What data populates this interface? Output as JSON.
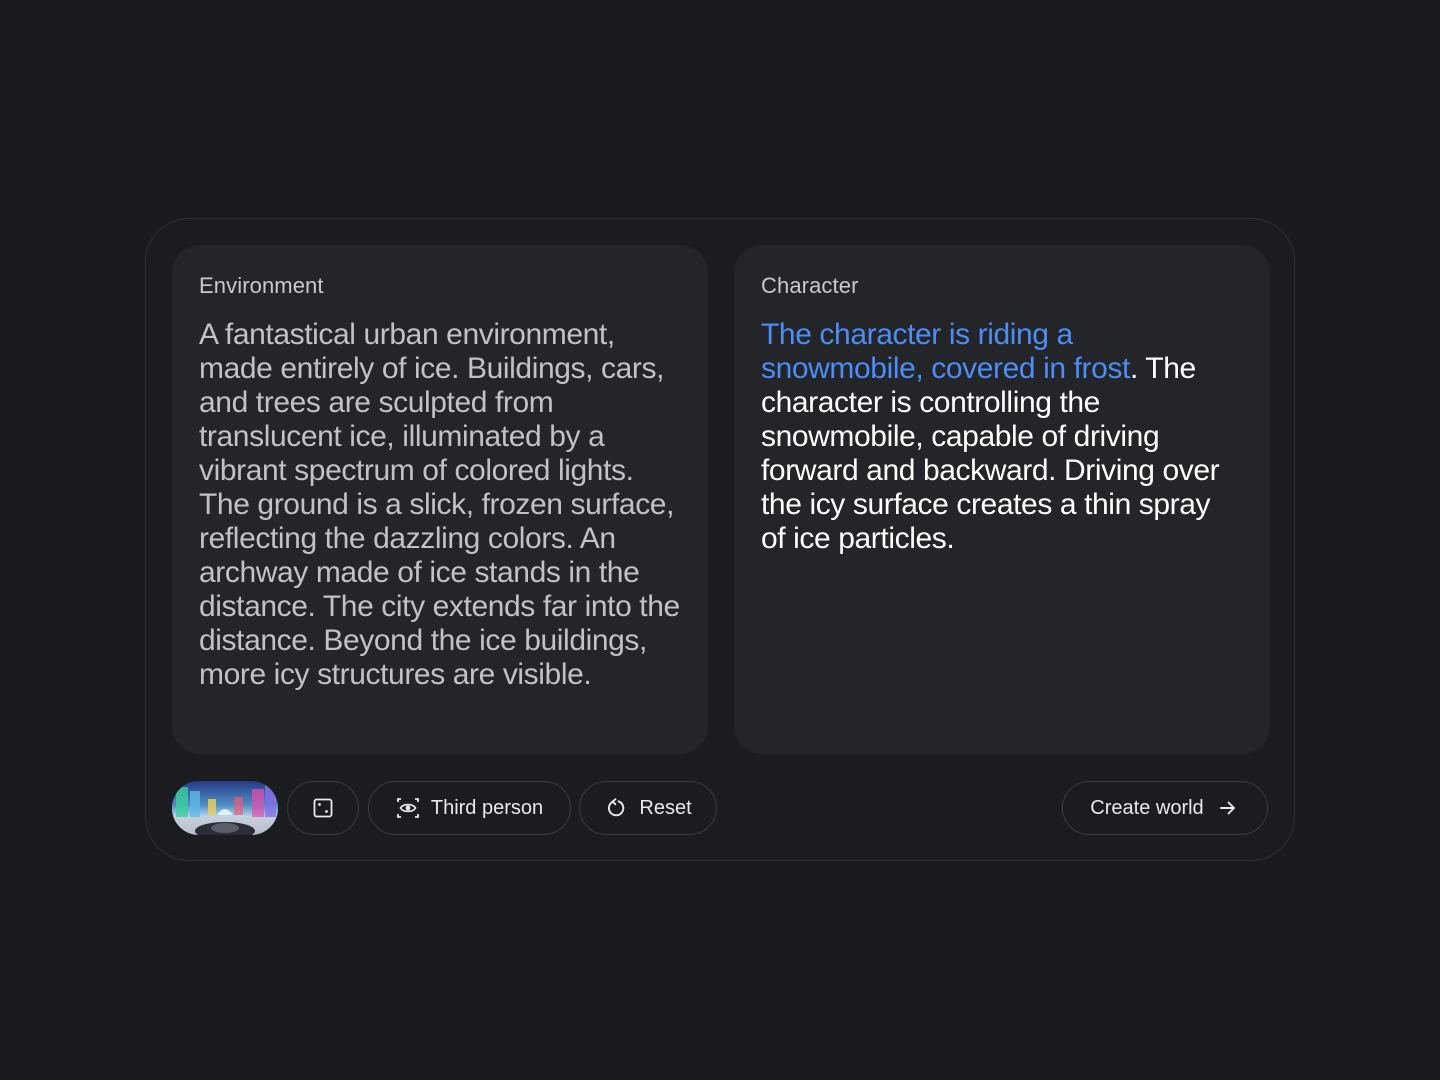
{
  "environment": {
    "label": "Environment",
    "text": "A fantastical urban environment, made entirely of ice. Buildings, cars, and trees are sculpted from translucent ice, illuminated by a vibrant spectrum of colored lights. The ground is a slick, frozen surface, reflecting the dazzling colors. An archway made of ice stands in the distance. The city extends far into the distance. Beyond the ice buildings, more icy structures are visible."
  },
  "character": {
    "label": "Character",
    "highlight_text": "The character is riding a snowmobile, covered in frost",
    "text": ". The character is controlling the snowmobile, capable of driving forward and backward. Driving over the icy surface creates a thin spray of ice particles.",
    "highlight_color": "#4c8df6"
  },
  "toolbar": {
    "thumbnail_icon": "preview-image",
    "dice_icon": "dice-icon",
    "view_icon": "eye-view-icon",
    "view_label": "Third person",
    "reset_icon": "refresh-icon",
    "reset_label": "Reset",
    "create_label": "Create world",
    "create_icon": "arrow-right-icon"
  },
  "colors": {
    "background": "#1a1b1e",
    "panel": "#242528",
    "accent": "#4c8df6"
  }
}
